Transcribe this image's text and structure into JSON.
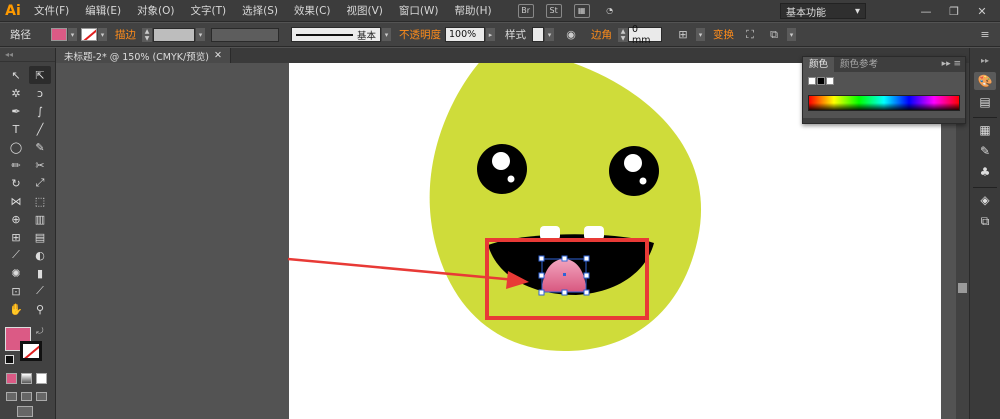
{
  "app": {
    "logo": "Ai"
  },
  "menu": [
    "文件(F)",
    "编辑(E)",
    "对象(O)",
    "文字(T)",
    "选择(S)",
    "效果(C)",
    "视图(V)",
    "窗口(W)",
    "帮助(H)"
  ],
  "menubar_icons": {
    "br": "Br",
    "st": "St"
  },
  "workspace": {
    "label": "基本功能",
    "arrow": "▾"
  },
  "window_controls": {
    "minimize": "—",
    "restore": "❐",
    "close": "✕"
  },
  "control": {
    "selection_type": "路径",
    "stroke_label": "描边",
    "profile_label": "基本",
    "opacity_label": "不透明度",
    "opacity_value": "100%",
    "style_label": "样式",
    "corner_label": "边角",
    "corner_value": "0 mm",
    "transform_label": "变换",
    "fill_color": "#db5a85"
  },
  "document": {
    "tab_title": "未标题-2* @ 150% (CMYK/预览)",
    "close": "✕"
  },
  "color_panel": {
    "tabs": [
      "颜色",
      "颜色参考"
    ],
    "active_tab": 0,
    "menu_icon": "▸▸ ≡"
  },
  "drawing": {
    "face_color": "#cfdc3a",
    "mouth_color": "#000000",
    "tongue_color": "#e0698f",
    "annotation_color": "#e83a36"
  }
}
